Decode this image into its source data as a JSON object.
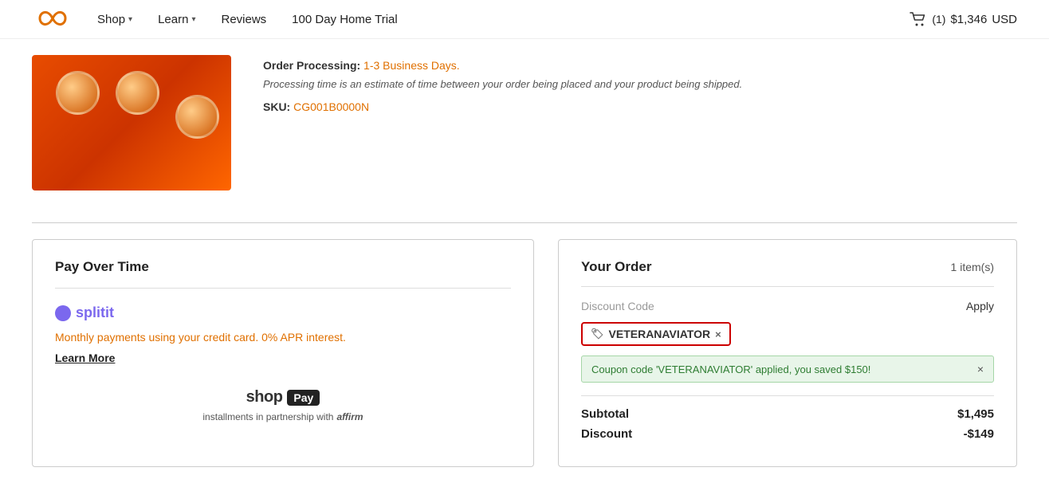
{
  "header": {
    "logo_alt": "infinity logo",
    "nav": [
      {
        "label": "Shop",
        "has_dropdown": true
      },
      {
        "label": "Learn",
        "has_dropdown": true
      },
      {
        "label": "Reviews",
        "has_dropdown": false
      },
      {
        "label": "100 Day Home Trial",
        "has_dropdown": false
      }
    ],
    "cart": {
      "count": "(1)",
      "amount": "$1,346",
      "currency": "USD"
    }
  },
  "product": {
    "order_processing_label": "Order Processing:",
    "order_processing_value": "1-3 Business Days.",
    "processing_note": "Processing time is an estimate of time between your order being placed and your product being shipped.",
    "sku_label": "SKU:",
    "sku_value": "CG001B0000N"
  },
  "pay_over_time": {
    "title": "Pay Over Time",
    "splitit": {
      "name_part1": "split",
      "name_part2": "it",
      "description": "Monthly payments using your credit card. 0% APR interest.",
      "learn_more": "Learn More"
    },
    "shop_pay": {
      "shop": "shop",
      "pay": "Pay",
      "note": "installments in partnership with",
      "partner": "affirm"
    }
  },
  "your_order": {
    "title": "Your Order",
    "item_count": "1 item(s)",
    "discount_code_placeholder": "Discount Code",
    "apply_label": "Apply",
    "coupon_code": "VETERANAVIATOR",
    "coupon_remove": "×",
    "coupon_success_msg": "Coupon code 'VETERANAVIATOR' applied, you saved $150!",
    "coupon_close": "×",
    "subtotal_label": "Subtotal",
    "subtotal_value": "$1,495",
    "discount_label": "Discount",
    "discount_value": "-$149"
  }
}
